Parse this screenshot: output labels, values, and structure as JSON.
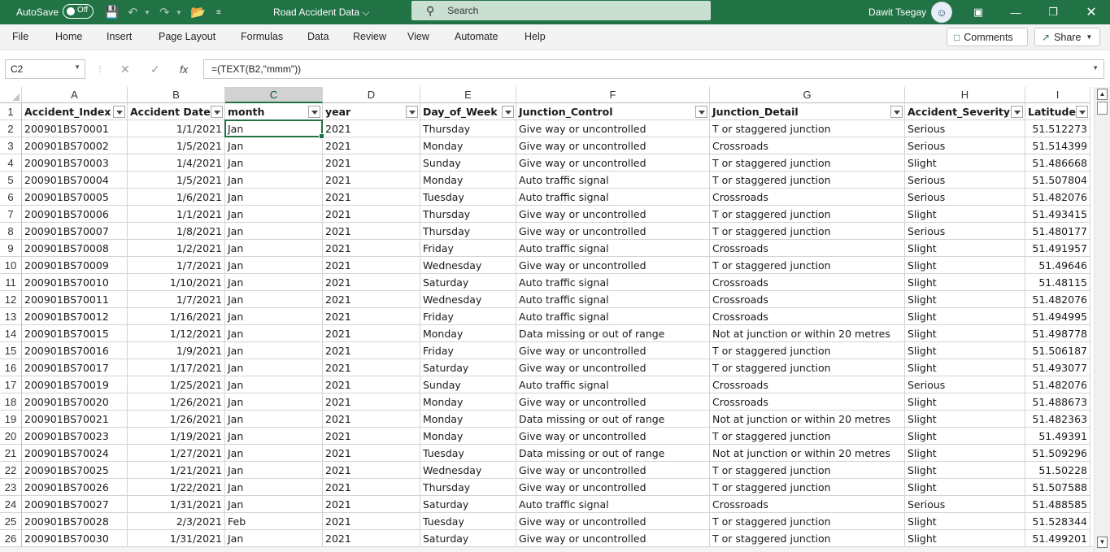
{
  "titlebar": {
    "autosave_label": "AutoSave",
    "autosave_state": "Off",
    "doc_title": "Road Accident Data ⌵",
    "search_placeholder": "Search",
    "user_name": "Dawit Tsegay",
    "bg_color": "#217346"
  },
  "menu": {
    "items": [
      "File",
      "Home",
      "Insert",
      "Page Layout",
      "Formulas",
      "Data",
      "Review",
      "View",
      "Automate",
      "Help"
    ],
    "comments_label": "Comments",
    "share_label": "Share"
  },
  "formula_bar": {
    "name_box": "C2",
    "formula": "=(TEXT(B2,\"mmm\"))"
  },
  "sheet": {
    "columns": [
      "A",
      "B",
      "C",
      "D",
      "E",
      "F",
      "G",
      "H",
      "I"
    ],
    "active_column": "C",
    "active_cell": "C2",
    "header_row": [
      "Accident_Index",
      "Accident Date",
      "month",
      "year",
      "Day_of_Week",
      "Junction_Control",
      "Junction_Detail",
      "Accident_Severity",
      "Latitude"
    ],
    "rows": [
      [
        "200901BS70001",
        "1/1/2021",
        "Jan",
        "2021",
        "Thursday",
        "Give way or uncontrolled",
        "T or staggered junction",
        "Serious",
        "51.512273"
      ],
      [
        "200901BS70002",
        "1/5/2021",
        "Jan",
        "2021",
        "Monday",
        "Give way or uncontrolled",
        "Crossroads",
        "Serious",
        "51.514399"
      ],
      [
        "200901BS70003",
        "1/4/2021",
        "Jan",
        "2021",
        "Sunday",
        "Give way or uncontrolled",
        "T or staggered junction",
        "Slight",
        "51.486668"
      ],
      [
        "200901BS70004",
        "1/5/2021",
        "Jan",
        "2021",
        "Monday",
        "Auto traffic signal",
        "T or staggered junction",
        "Serious",
        "51.507804"
      ],
      [
        "200901BS70005",
        "1/6/2021",
        "Jan",
        "2021",
        "Tuesday",
        "Auto traffic signal",
        "Crossroads",
        "Serious",
        "51.482076"
      ],
      [
        "200901BS70006",
        "1/1/2021",
        "Jan",
        "2021",
        "Thursday",
        "Give way or uncontrolled",
        "T or staggered junction",
        "Slight",
        "51.493415"
      ],
      [
        "200901BS70007",
        "1/8/2021",
        "Jan",
        "2021",
        "Thursday",
        "Give way or uncontrolled",
        "T or staggered junction",
        "Serious",
        "51.480177"
      ],
      [
        "200901BS70008",
        "1/2/2021",
        "Jan",
        "2021",
        "Friday",
        "Auto traffic signal",
        "Crossroads",
        "Slight",
        "51.491957"
      ],
      [
        "200901BS70009",
        "1/7/2021",
        "Jan",
        "2021",
        "Wednesday",
        "Give way or uncontrolled",
        "T or staggered junction",
        "Slight",
        "51.49646"
      ],
      [
        "200901BS70010",
        "1/10/2021",
        "Jan",
        "2021",
        "Saturday",
        "Auto traffic signal",
        "Crossroads",
        "Slight",
        "51.48115"
      ],
      [
        "200901BS70011",
        "1/7/2021",
        "Jan",
        "2021",
        "Wednesday",
        "Auto traffic signal",
        "Crossroads",
        "Slight",
        "51.482076"
      ],
      [
        "200901BS70012",
        "1/16/2021",
        "Jan",
        "2021",
        "Friday",
        "Auto traffic signal",
        "Crossroads",
        "Slight",
        "51.494995"
      ],
      [
        "200901BS70015",
        "1/12/2021",
        "Jan",
        "2021",
        "Monday",
        "Data missing or out of range",
        "Not at junction or within 20 metres",
        "Slight",
        "51.498778"
      ],
      [
        "200901BS70016",
        "1/9/2021",
        "Jan",
        "2021",
        "Friday",
        "Give way or uncontrolled",
        "T or staggered junction",
        "Slight",
        "51.506187"
      ],
      [
        "200901BS70017",
        "1/17/2021",
        "Jan",
        "2021",
        "Saturday",
        "Give way or uncontrolled",
        "T or staggered junction",
        "Slight",
        "51.493077"
      ],
      [
        "200901BS70019",
        "1/25/2021",
        "Jan",
        "2021",
        "Sunday",
        "Auto traffic signal",
        "Crossroads",
        "Serious",
        "51.482076"
      ],
      [
        "200901BS70020",
        "1/26/2021",
        "Jan",
        "2021",
        "Monday",
        "Give way or uncontrolled",
        "Crossroads",
        "Slight",
        "51.488673"
      ],
      [
        "200901BS70021",
        "1/26/2021",
        "Jan",
        "2021",
        "Monday",
        "Data missing or out of range",
        "Not at junction or within 20 metres",
        "Slight",
        "51.482363"
      ],
      [
        "200901BS70023",
        "1/19/2021",
        "Jan",
        "2021",
        "Monday",
        "Give way or uncontrolled",
        "T or staggered junction",
        "Slight",
        "51.49391"
      ],
      [
        "200901BS70024",
        "1/27/2021",
        "Jan",
        "2021",
        "Tuesday",
        "Data missing or out of range",
        "Not at junction or within 20 metres",
        "Slight",
        "51.509296"
      ],
      [
        "200901BS70025",
        "1/21/2021",
        "Jan",
        "2021",
        "Wednesday",
        "Give way or uncontrolled",
        "T or staggered junction",
        "Slight",
        "51.50228"
      ],
      [
        "200901BS70026",
        "1/22/2021",
        "Jan",
        "2021",
        "Thursday",
        "Give way or uncontrolled",
        "T or staggered junction",
        "Slight",
        "51.507588"
      ],
      [
        "200901BS70027",
        "1/31/2021",
        "Jan",
        "2021",
        "Saturday",
        "Auto traffic signal",
        "Crossroads",
        "Serious",
        "51.488585"
      ],
      [
        "200901BS70028",
        "2/3/2021",
        "Feb",
        "2021",
        "Tuesday",
        "Give way or uncontrolled",
        "T or staggered junction",
        "Slight",
        "51.528344"
      ],
      [
        "200901BS70030",
        "1/31/2021",
        "Jan",
        "2021",
        "Saturday",
        "Give way or uncontrolled",
        "T or staggered junction",
        "Slight",
        "51.499201"
      ]
    ]
  }
}
